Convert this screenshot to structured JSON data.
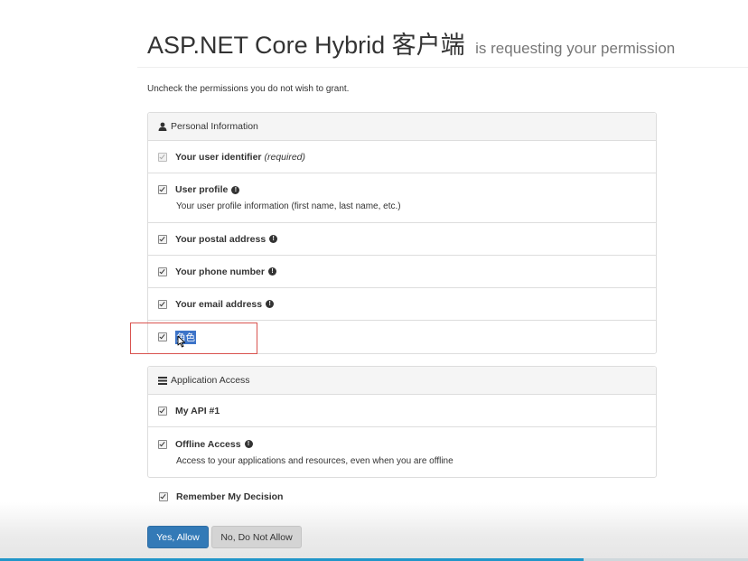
{
  "header": {
    "client_name": "ASP.NET Core Hybrid 客户端",
    "requesting_text": "is requesting your permission"
  },
  "instruction": "Uncheck the permissions you do not wish to grant.",
  "personal_panel": {
    "heading": "Personal Information",
    "icon": "user-icon",
    "items": [
      {
        "label": "Your user identifier",
        "note": "(required)",
        "checked": true,
        "disabled": true
      },
      {
        "label": "User profile",
        "description": "Your user profile information (first name, last name, etc.)",
        "checked": true
      },
      {
        "label": "Your postal address",
        "checked": true
      },
      {
        "label": "Your phone number",
        "checked": true
      },
      {
        "label": "Your email address",
        "checked": true
      },
      {
        "label": "角色",
        "checked": true,
        "selected": true
      }
    ]
  },
  "application_panel": {
    "heading": "Application Access",
    "icon": "list-icon",
    "items": [
      {
        "label": "My API #1",
        "checked": true
      },
      {
        "label": "Offline Access",
        "description": "Access to your applications and resources, even when you are offline",
        "checked": true
      }
    ]
  },
  "remember": {
    "label": "Remember My Decision",
    "checked": true
  },
  "buttons": {
    "allow": "Yes, Allow",
    "deny": "No, Do Not Allow"
  },
  "progress": {
    "fraction": 0.78
  },
  "colors": {
    "primary": "#337ab7",
    "highlight": "#d9534f",
    "selection": "#3d74c8"
  }
}
